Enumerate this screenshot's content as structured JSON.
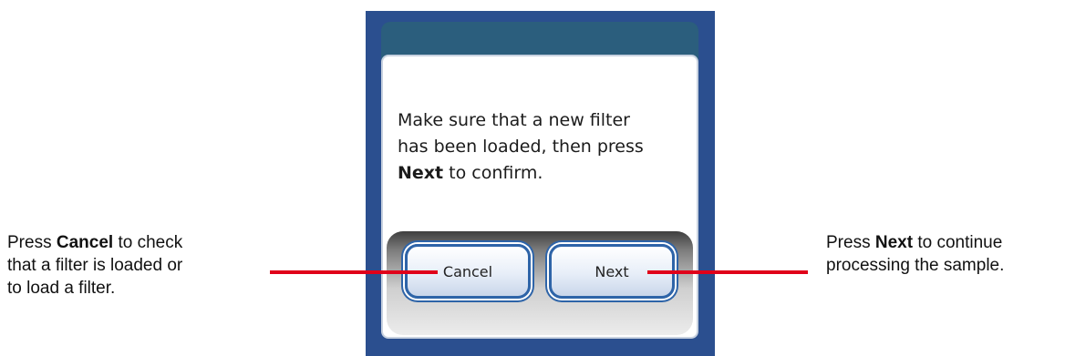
{
  "callouts": {
    "left": {
      "prefix": "Press ",
      "bold": "Cancel",
      "suffix_line1": " to check",
      "line2": "that a filter is loaded or",
      "line3": "to load a filter."
    },
    "right": {
      "prefix": "Press ",
      "bold": "Next",
      "suffix_line1": " to continue",
      "line2": "processing the sample."
    }
  },
  "dialog": {
    "message_line1": "Make sure that a new filter",
    "message_line2": "has been loaded, then press",
    "message_bold": "Next",
    "message_suffix": " to confirm."
  },
  "buttons": {
    "cancel_label": "Cancel",
    "next_label": "Next"
  },
  "colors": {
    "device_blue": "#2b4f8f",
    "title_bar": "#2b5e7d",
    "button_border": "#2e64a8",
    "callout_line": "#e0001a"
  }
}
